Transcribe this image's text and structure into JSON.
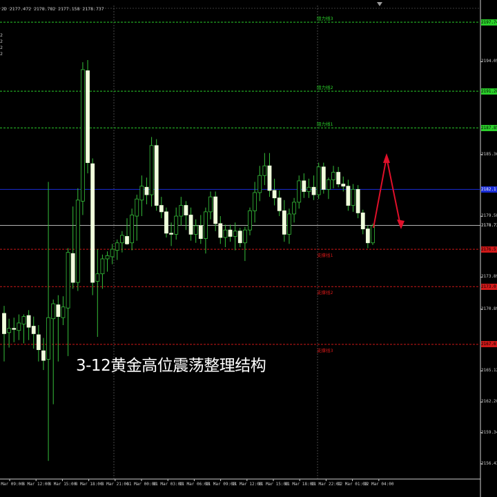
{
  "chart": {
    "info_line": "2D  2177.472 2178.782 2177.158 2178.737",
    "left_digits": [
      "2",
      "2",
      "2",
      "2"
    ],
    "caption": "3-12黄金高位震荡整理结构",
    "colors": {
      "background": "#000000",
      "candle_body": "#f0ffdc",
      "candle_wick": "#36c03a",
      "grid": "#7a7a7a",
      "resistance": "#2ad02a",
      "support": "#d01818",
      "pivot": "#1a2dd8",
      "current_price": "#cfcfcf",
      "arrow": "#e0102a"
    }
  },
  "price_axis": {
    "labels": [
      "2194.050",
      "2185.360",
      "2179.585",
      "2173.890",
      "2170.895",
      "2165.120",
      "2162.205",
      "2159.345",
      "2156.430"
    ],
    "current_price": "2178.737"
  },
  "levels": [
    {
      "kind": "resistance",
      "label": "阻力线3",
      "price": "2197.740"
    },
    {
      "kind": "resistance",
      "label": "阻力线2",
      "price": "2191.285"
    },
    {
      "kind": "resistance",
      "label": "阻力线1",
      "price": "2187.852"
    },
    {
      "kind": "pivot",
      "label": "",
      "price": "2182.1"
    },
    {
      "kind": "support",
      "label": "支撑线1",
      "price": "2176.5"
    },
    {
      "kind": "support",
      "label": "支撑线2",
      "price": "2173.0"
    },
    {
      "kind": "support",
      "label": "支撑线3",
      "price": "2167.6"
    }
  ],
  "time_axis": [
    "8 Mar 09:00",
    "8 Mar 12:00",
    "8 Mar 15:00",
    "8 Mar 18:00",
    "8 Mar 21:00",
    "11 Mar 00:00",
    "11 Mar 03:00",
    "11 Mar 06:00",
    "11 Mar 09:00",
    "11 Mar 12:00",
    "11 Mar 15:00",
    "11 Mar 18:00",
    "11 Mar 22:01",
    "12 Mar 01:00",
    "12 Mar 04:00"
  ],
  "chart_data": {
    "type": "candlestick",
    "timeframe": "H1",
    "y_unit": "USD",
    "candles": [
      {
        "o": 2170.5,
        "h": 2171.2,
        "l": 2166.0,
        "c": 2168.6
      },
      {
        "o": 2168.7,
        "h": 2170.0,
        "l": 2167.3,
        "c": 2169.1
      },
      {
        "o": 2169.1,
        "h": 2170.1,
        "l": 2167.8,
        "c": 2169.0
      },
      {
        "o": 2168.9,
        "h": 2170.4,
        "l": 2168.0,
        "c": 2169.6
      },
      {
        "o": 2169.5,
        "h": 2170.4,
        "l": 2167.7,
        "c": 2170.2
      },
      {
        "o": 2170.3,
        "h": 2170.8,
        "l": 2168.0,
        "c": 2169.2
      },
      {
        "o": 2169.3,
        "h": 2170.2,
        "l": 2167.2,
        "c": 2168.6
      },
      {
        "o": 2168.5,
        "h": 2169.4,
        "l": 2166.0,
        "c": 2167.1
      },
      {
        "o": 2167.0,
        "h": 2168.2,
        "l": 2165.2,
        "c": 2166.1
      },
      {
        "o": 2166.2,
        "h": 2182.8,
        "l": 2156.7,
        "c": 2170.1
      },
      {
        "o": 2170.0,
        "h": 2171.8,
        "l": 2162.0,
        "c": 2171.4
      },
      {
        "o": 2171.3,
        "h": 2172.2,
        "l": 2166.0,
        "c": 2170.2
      },
      {
        "o": 2170.1,
        "h": 2172.1,
        "l": 2169.4,
        "c": 2171.1
      },
      {
        "o": 2171.0,
        "h": 2176.6,
        "l": 2166.5,
        "c": 2176.2
      },
      {
        "o": 2176.1,
        "h": 2180.5,
        "l": 2172.8,
        "c": 2173.4
      },
      {
        "o": 2173.4,
        "h": 2182.2,
        "l": 2172.6,
        "c": 2181.1
      },
      {
        "o": 2181.0,
        "h": 2194.0,
        "l": 2179.7,
        "c": 2193.3
      },
      {
        "o": 2193.2,
        "h": 2194.2,
        "l": 2183.6,
        "c": 2184.6
      },
      {
        "o": 2184.5,
        "h": 2185.0,
        "l": 2172.2,
        "c": 2173.4
      },
      {
        "o": 2173.5,
        "h": 2176.5,
        "l": 2168.3,
        "c": 2174.2
      },
      {
        "o": 2174.2,
        "h": 2176.0,
        "l": 2172.8,
        "c": 2175.6
      },
      {
        "o": 2175.6,
        "h": 2176.3,
        "l": 2174.4,
        "c": 2175.9
      },
      {
        "o": 2175.8,
        "h": 2177.0,
        "l": 2175.1,
        "c": 2176.5
      },
      {
        "o": 2176.4,
        "h": 2177.4,
        "l": 2175.5,
        "c": 2177.1
      },
      {
        "o": 2177.1,
        "h": 2178.2,
        "l": 2176.2,
        "c": 2177.8
      },
      {
        "o": 2177.7,
        "h": 2179.4,
        "l": 2176.9,
        "c": 2177.0
      },
      {
        "o": 2177.1,
        "h": 2180.3,
        "l": 2176.4,
        "c": 2179.7
      },
      {
        "o": 2179.6,
        "h": 2181.6,
        "l": 2177.3,
        "c": 2181.2
      },
      {
        "o": 2181.1,
        "h": 2183.4,
        "l": 2179.6,
        "c": 2182.4
      },
      {
        "o": 2182.3,
        "h": 2183.2,
        "l": 2180.7,
        "c": 2181.6
      },
      {
        "o": 2181.6,
        "h": 2187.0,
        "l": 2180.5,
        "c": 2186.2
      },
      {
        "o": 2186.2,
        "h": 2186.8,
        "l": 2180.1,
        "c": 2180.6
      },
      {
        "o": 2180.6,
        "h": 2181.4,
        "l": 2179.4,
        "c": 2180.0
      },
      {
        "o": 2180.0,
        "h": 2180.4,
        "l": 2177.6,
        "c": 2178.0
      },
      {
        "o": 2178.0,
        "h": 2179.0,
        "l": 2176.8,
        "c": 2177.9
      },
      {
        "o": 2177.9,
        "h": 2180.4,
        "l": 2177.4,
        "c": 2179.6
      },
      {
        "o": 2179.6,
        "h": 2181.4,
        "l": 2178.7,
        "c": 2180.6
      },
      {
        "o": 2180.6,
        "h": 2181.0,
        "l": 2178.3,
        "c": 2179.7
      },
      {
        "o": 2179.7,
        "h": 2180.4,
        "l": 2177.3,
        "c": 2177.9
      },
      {
        "o": 2177.9,
        "h": 2179.3,
        "l": 2177.1,
        "c": 2178.7
      },
      {
        "o": 2178.7,
        "h": 2179.7,
        "l": 2177.0,
        "c": 2177.5
      },
      {
        "o": 2177.5,
        "h": 2180.4,
        "l": 2176.1,
        "c": 2180.0
      },
      {
        "o": 2180.0,
        "h": 2181.9,
        "l": 2179.3,
        "c": 2181.4
      },
      {
        "o": 2181.4,
        "h": 2181.9,
        "l": 2178.2,
        "c": 2178.9
      },
      {
        "o": 2178.9,
        "h": 2179.6,
        "l": 2177.0,
        "c": 2177.6
      },
      {
        "o": 2177.6,
        "h": 2178.8,
        "l": 2176.7,
        "c": 2178.3
      },
      {
        "o": 2178.3,
        "h": 2178.8,
        "l": 2177.2,
        "c": 2177.7
      },
      {
        "o": 2177.7,
        "h": 2179.0,
        "l": 2176.4,
        "c": 2178.2
      },
      {
        "o": 2178.2,
        "h": 2178.5,
        "l": 2176.7,
        "c": 2177.1
      },
      {
        "o": 2177.1,
        "h": 2178.6,
        "l": 2175.4,
        "c": 2178.3
      },
      {
        "o": 2178.3,
        "h": 2180.4,
        "l": 2177.8,
        "c": 2180.1
      },
      {
        "o": 2180.1,
        "h": 2182.8,
        "l": 2179.0,
        "c": 2181.8
      },
      {
        "o": 2181.8,
        "h": 2184.3,
        "l": 2181.0,
        "c": 2183.4
      },
      {
        "o": 2183.4,
        "h": 2185.5,
        "l": 2182.5,
        "c": 2184.3
      },
      {
        "o": 2184.3,
        "h": 2185.5,
        "l": 2181.4,
        "c": 2182.0
      },
      {
        "o": 2182.0,
        "h": 2183.1,
        "l": 2180.6,
        "c": 2181.3
      },
      {
        "o": 2181.3,
        "h": 2182.0,
        "l": 2179.6,
        "c": 2180.1
      },
      {
        "o": 2180.1,
        "h": 2181.1,
        "l": 2177.2,
        "c": 2177.9
      },
      {
        "o": 2177.9,
        "h": 2180.3,
        "l": 2177.0,
        "c": 2179.8
      },
      {
        "o": 2179.8,
        "h": 2181.3,
        "l": 2179.0,
        "c": 2180.9
      },
      {
        "o": 2180.9,
        "h": 2183.4,
        "l": 2180.3,
        "c": 2182.9
      },
      {
        "o": 2182.9,
        "h": 2183.6,
        "l": 2181.3,
        "c": 2181.9
      },
      {
        "o": 2181.9,
        "h": 2183.1,
        "l": 2181.3,
        "c": 2182.3
      },
      {
        "o": 2182.3,
        "h": 2183.4,
        "l": 2181.1,
        "c": 2181.6
      },
      {
        "o": 2181.6,
        "h": 2184.6,
        "l": 2181.2,
        "c": 2184.2
      },
      {
        "o": 2184.2,
        "h": 2184.6,
        "l": 2181.7,
        "c": 2182.1
      },
      {
        "o": 2182.1,
        "h": 2183.2,
        "l": 2181.2,
        "c": 2183.0
      },
      {
        "o": 2183.0,
        "h": 2184.3,
        "l": 2182.2,
        "c": 2183.7
      },
      {
        "o": 2183.7,
        "h": 2184.2,
        "l": 2182.3,
        "c": 2182.6
      },
      {
        "o": 2182.6,
        "h": 2183.3,
        "l": 2181.9,
        "c": 2182.4
      },
      {
        "o": 2182.4,
        "h": 2183.0,
        "l": 2180.1,
        "c": 2180.6
      },
      {
        "o": 2180.6,
        "h": 2182.6,
        "l": 2180.0,
        "c": 2182.1
      },
      {
        "o": 2182.1,
        "h": 2182.5,
        "l": 2179.4,
        "c": 2179.9
      },
      {
        "o": 2179.9,
        "h": 2180.2,
        "l": 2177.9,
        "c": 2178.4
      },
      {
        "o": 2178.4,
        "h": 2178.7,
        "l": 2176.6,
        "c": 2177.1
      },
      {
        "o": 2177.1,
        "h": 2178.9,
        "l": 2176.9,
        "c": 2178.7
      }
    ]
  }
}
